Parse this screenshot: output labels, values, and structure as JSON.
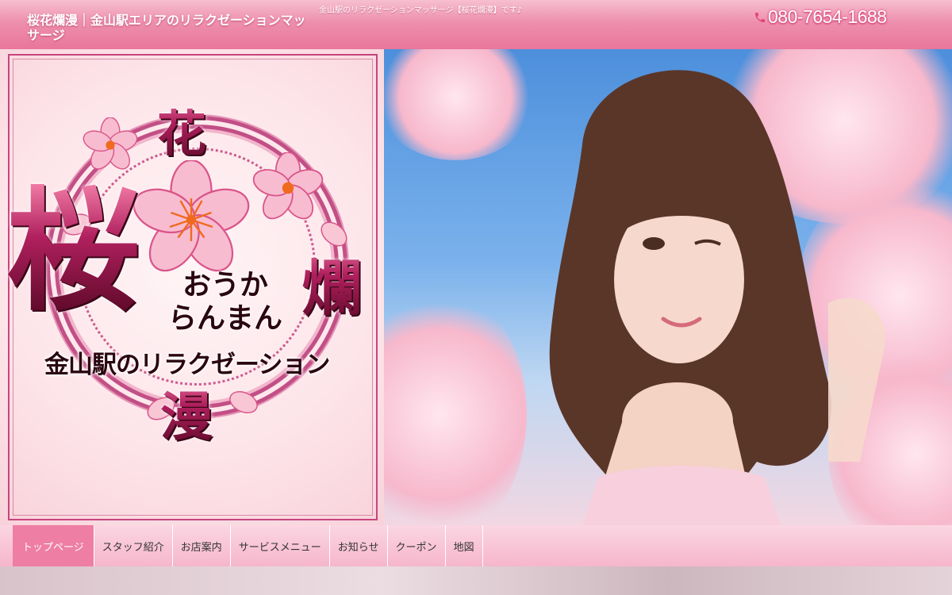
{
  "header": {
    "site_title": "桜花爛漫｜金山駅エリアのリラクゼーションマッサージ",
    "tagline": "金山駅のリラクゼーションマッサージ【桜花爛漫】です♪",
    "phone": "080-7654-1688",
    "phone_icon": "phone-icon",
    "accent_color": "#e8769b"
  },
  "hero": {
    "logo": {
      "kanji_top": "花",
      "kanji_main": "桜",
      "kanji_right": "爛",
      "kanji_bottom": "漫",
      "reading_line1": "おうか",
      "reading_line2": "らんまん",
      "subtitle": "金山駅のリラクゼーション"
    }
  },
  "nav": {
    "items": [
      {
        "label": "トップページ",
        "active": true
      },
      {
        "label": "スタッフ紹介",
        "active": false
      },
      {
        "label": "お店案内",
        "active": false
      },
      {
        "label": "サービスメニュー",
        "active": false
      },
      {
        "label": "お知らせ",
        "active": false
      },
      {
        "label": "クーポン",
        "active": false
      },
      {
        "label": "地図",
        "active": false
      }
    ],
    "active_color": "#ee7ea3"
  }
}
